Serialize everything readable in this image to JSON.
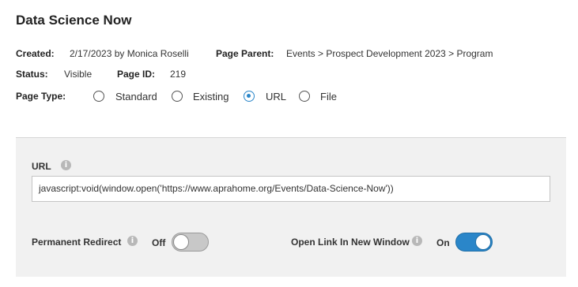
{
  "page": {
    "title": "Data Science Now",
    "created_label": "Created:",
    "created_value": "2/17/2023 by Monica Roselli",
    "parent_label": "Page Parent:",
    "parent_value": "Events > Prospect Development 2023 > Program",
    "status_label": "Status:",
    "status_value": "Visible",
    "pageid_label": "Page ID:",
    "pageid_value": "219",
    "pagetype_label": "Page Type:",
    "page_types": [
      {
        "label": "Standard",
        "selected": false
      },
      {
        "label": "Existing",
        "selected": false
      },
      {
        "label": "URL",
        "selected": true
      },
      {
        "label": "File",
        "selected": false
      }
    ]
  },
  "url_section": {
    "label": "URL",
    "value": "javascript:void(window.open('https://www.aprahome.org/Events/Data-Science-Now'))",
    "permanent_redirect": {
      "label": "Permanent Redirect",
      "state_text": "Off",
      "on": false
    },
    "open_new_window": {
      "label": "Open Link In New Window",
      "state_text": "On",
      "on": true
    }
  },
  "colors": {
    "accent": "#2a86c9",
    "panel_bg": "#f1f1f1"
  }
}
